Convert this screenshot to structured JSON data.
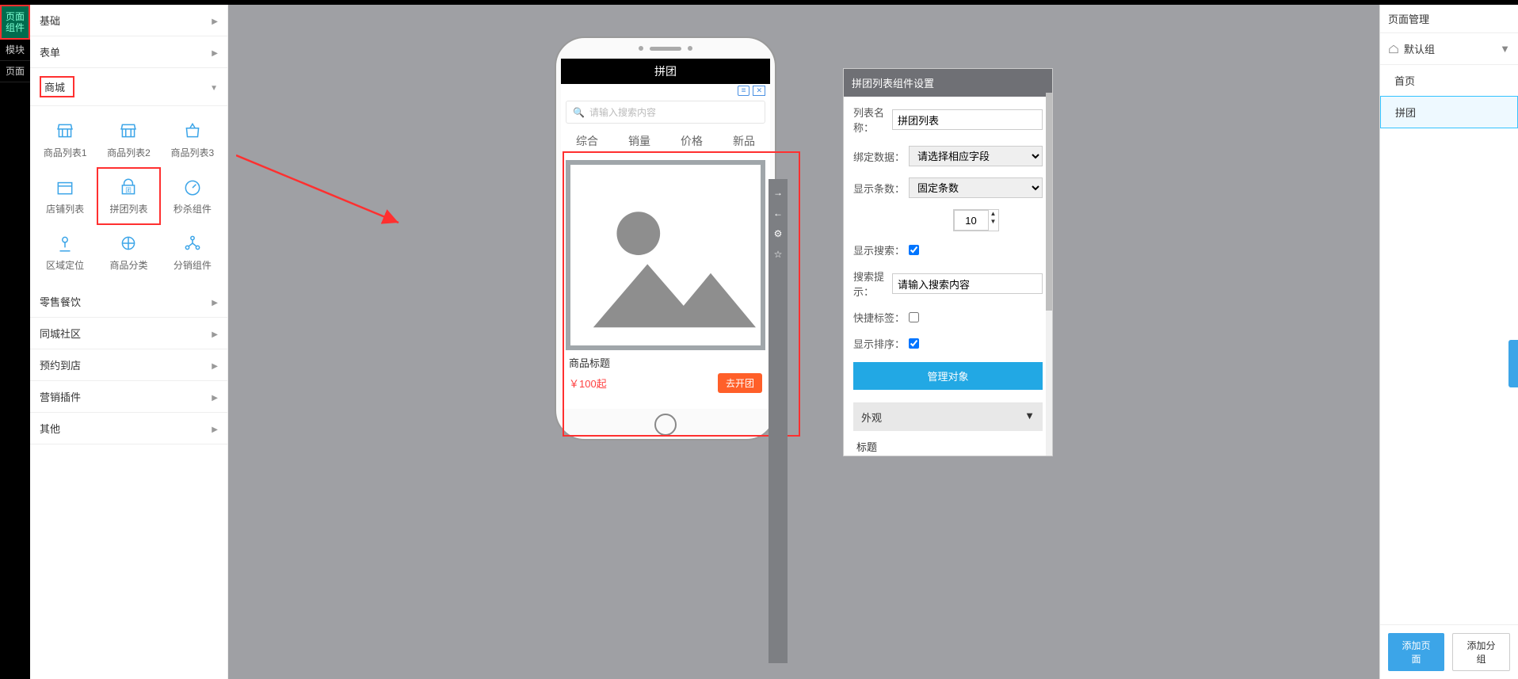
{
  "leftTabs": [
    "页面\n组件",
    "模块",
    "页面"
  ],
  "categories": [
    {
      "label": "基础",
      "expanded": false
    },
    {
      "label": "表单",
      "expanded": false
    },
    {
      "label": "商城",
      "expanded": true,
      "highlighted": true
    },
    {
      "label": "零售餐饮",
      "expanded": false
    },
    {
      "label": "同城社区",
      "expanded": false
    },
    {
      "label": "预约到店",
      "expanded": false
    },
    {
      "label": "营销插件",
      "expanded": false
    },
    {
      "label": "其他",
      "expanded": false
    }
  ],
  "components": [
    {
      "label": "商品列表1"
    },
    {
      "label": "商品列表2"
    },
    {
      "label": "商品列表3"
    },
    {
      "label": "店铺列表"
    },
    {
      "label": "拼团列表",
      "highlighted": true
    },
    {
      "label": "秒杀组件"
    },
    {
      "label": "区域定位"
    },
    {
      "label": "商品分类"
    },
    {
      "label": "分销组件"
    }
  ],
  "phone": {
    "title": "拼团",
    "searchPlaceholder": "请输入搜索内容",
    "tabs": [
      "综合",
      "销量",
      "价格",
      "新品"
    ],
    "card": {
      "title": "商品标题",
      "price": "￥100起",
      "button": "去开团"
    }
  },
  "toolbar": {
    "items": [
      "→",
      "←",
      "⚙",
      "☆"
    ]
  },
  "settings": {
    "header": "拼团列表组件设置",
    "fields": {
      "listNameLabel": "列表名称：",
      "listNameValue": "拼团列表",
      "dataBindLabel": "绑定数据：",
      "dataBindValue": "请选择相应字段",
      "countLabel": "显示条数：",
      "countMode": "固定条数",
      "countValue": "10",
      "showSearchLabel": "显示搜索：",
      "showSearchChecked": true,
      "searchHintLabel": "搜索提示：",
      "searchHintValue": "请输入搜索内容",
      "quickTagLabel": "快捷标签：",
      "quickTagChecked": false,
      "showSortLabel": "显示排序：",
      "showSortChecked": true
    },
    "manageBtn": "管理对象",
    "appearanceTitle": "外观",
    "appearanceSub": "标题"
  },
  "pageMgr": {
    "title": "页面管理",
    "group": "默认组",
    "pages": [
      {
        "label": "首页",
        "active": false
      },
      {
        "label": "拼团",
        "active": true
      }
    ],
    "addPage": "添加页面",
    "addGroup": "添加分组"
  }
}
